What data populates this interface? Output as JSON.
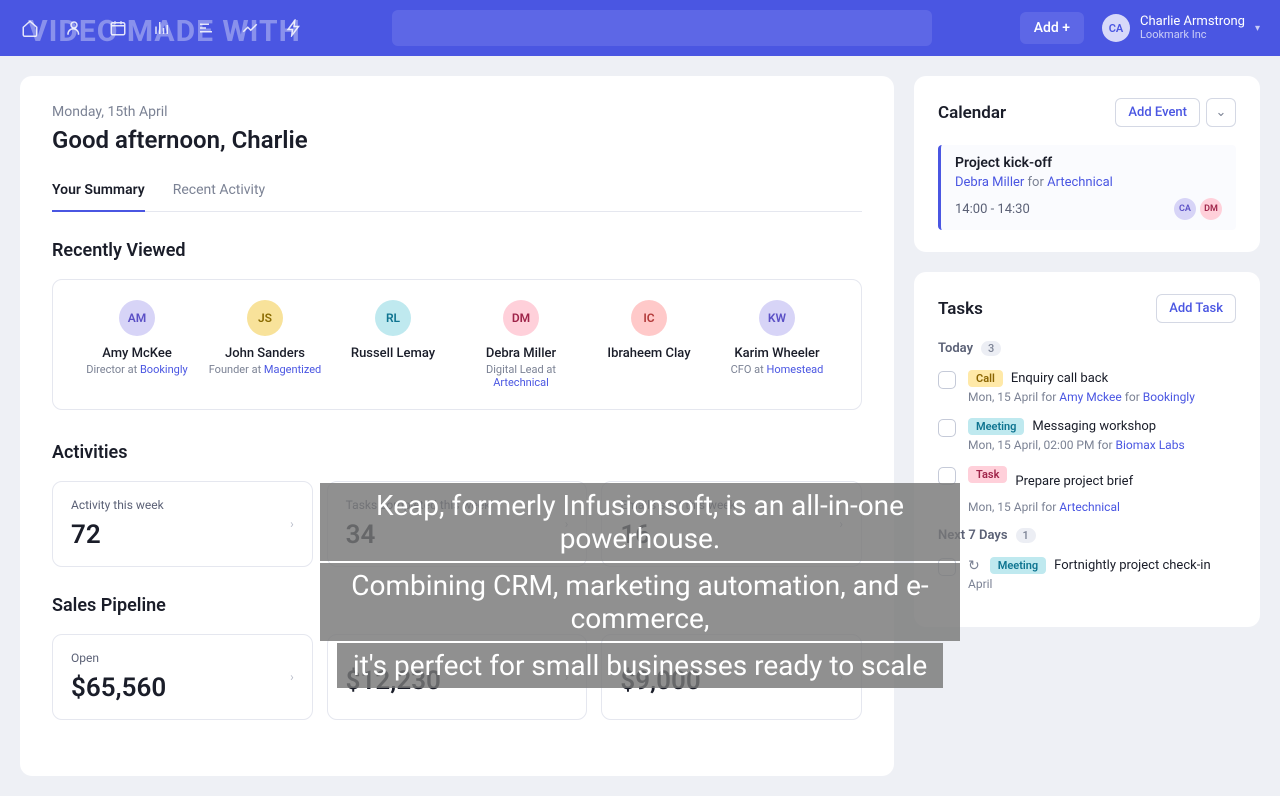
{
  "topbar": {
    "add_label": "Add +",
    "user_initials": "CA",
    "user_name": "Charlie Armstrong",
    "user_org": "Lookmark Inc"
  },
  "main": {
    "date": "Monday, 15th April",
    "greeting": "Good afternoon, Charlie",
    "tabs": {
      "summary": "Your Summary",
      "recent": "Recent Activity"
    },
    "recently_viewed_title": "Recently Viewed",
    "contacts": [
      {
        "initials": "AM",
        "color": "#d7d4f7",
        "tc": "#5b50c6",
        "name": "Amy McKee",
        "role": "Director at ",
        "company": "Bookingly"
      },
      {
        "initials": "JS",
        "color": "#f8e29a",
        "tc": "#8a6b00",
        "name": "John Sanders",
        "role": "Founder at ",
        "company": "Magentized"
      },
      {
        "initials": "RL",
        "color": "#bfe9ef",
        "tc": "#0e7490",
        "name": "Russell Lemay",
        "role": "",
        "company": ""
      },
      {
        "initials": "DM",
        "color": "#ffd0da",
        "tc": "#9f2449",
        "name": "Debra Miller",
        "role": "Digital Lead at ",
        "company": "Artechnical"
      },
      {
        "initials": "IC",
        "color": "#ffc9c9",
        "tc": "#b33a3a",
        "name": "Ibraheem Clay",
        "role": "",
        "company": ""
      },
      {
        "initials": "KW",
        "color": "#d7d4f7",
        "tc": "#5b50c6",
        "name": "Karim Wheeler",
        "role": "CFO at ",
        "company": "Homestead"
      }
    ],
    "activities_title": "Activities",
    "activities": [
      {
        "label": "Activity this week",
        "value": "72"
      },
      {
        "label": "Tasks completed this week",
        "value": "34"
      },
      {
        "label": "Emails sent this week",
        "value": "16"
      }
    ],
    "pipeline_title": "Sales Pipeline",
    "pipeline": [
      {
        "label": "Open",
        "value": "$65,560"
      },
      {
        "label": "",
        "value": "$12,230"
      },
      {
        "label": "",
        "value": "$9,000"
      }
    ]
  },
  "calendar": {
    "title": "Calendar",
    "add": "Add Event",
    "event": {
      "title": "Project kick-off",
      "person": "Debra Miller",
      "for": " for ",
      "company": "Artechnical",
      "time": "14:00 - 14:30",
      "avatars": [
        {
          "initials": "CA",
          "bg": "#d7d4f7",
          "tc": "#5b50c6"
        },
        {
          "initials": "DM",
          "bg": "#ffd0da",
          "tc": "#9f2449"
        }
      ]
    }
  },
  "tasks": {
    "title": "Tasks",
    "add": "Add Task",
    "today_label": "Today",
    "today_count": "3",
    "next_label": "Next 7 Days",
    "next_count": "1",
    "items": [
      {
        "tag": "Call",
        "tag_cls": "call",
        "title": "Enquiry call back",
        "sub_pre": "Mon, 15 April for ",
        "link1": "Amy Mckee",
        "mid": " for ",
        "link2": "Bookingly"
      },
      {
        "tag": "Meeting",
        "tag_cls": "meeting",
        "title": "Messaging workshop",
        "sub_pre": "Mon, 15 April, 02:00 PM for ",
        "link1": "Biomax Labs",
        "mid": "",
        "link2": ""
      },
      {
        "tag": "Task",
        "tag_cls": "task",
        "title": "Prepare project brief",
        "sub_pre": "Mon, 15 April for ",
        "link1": "Artechnical",
        "mid": "",
        "link2": ""
      }
    ],
    "next_items": [
      {
        "tag": "Meeting",
        "tag_cls": "meeting",
        "title": "Fortnightly project check-in",
        "sub_pre": "April",
        "link1": "",
        "mid": "",
        "link2": ""
      }
    ]
  },
  "watermark": "VIDEO MADE WITH",
  "caption": [
    "Keap, formerly Infusionsoft, is an all-in-one powerhouse.",
    "Combining CRM, marketing automation, and e-commerce,",
    "it's perfect for small businesses ready to scale"
  ]
}
